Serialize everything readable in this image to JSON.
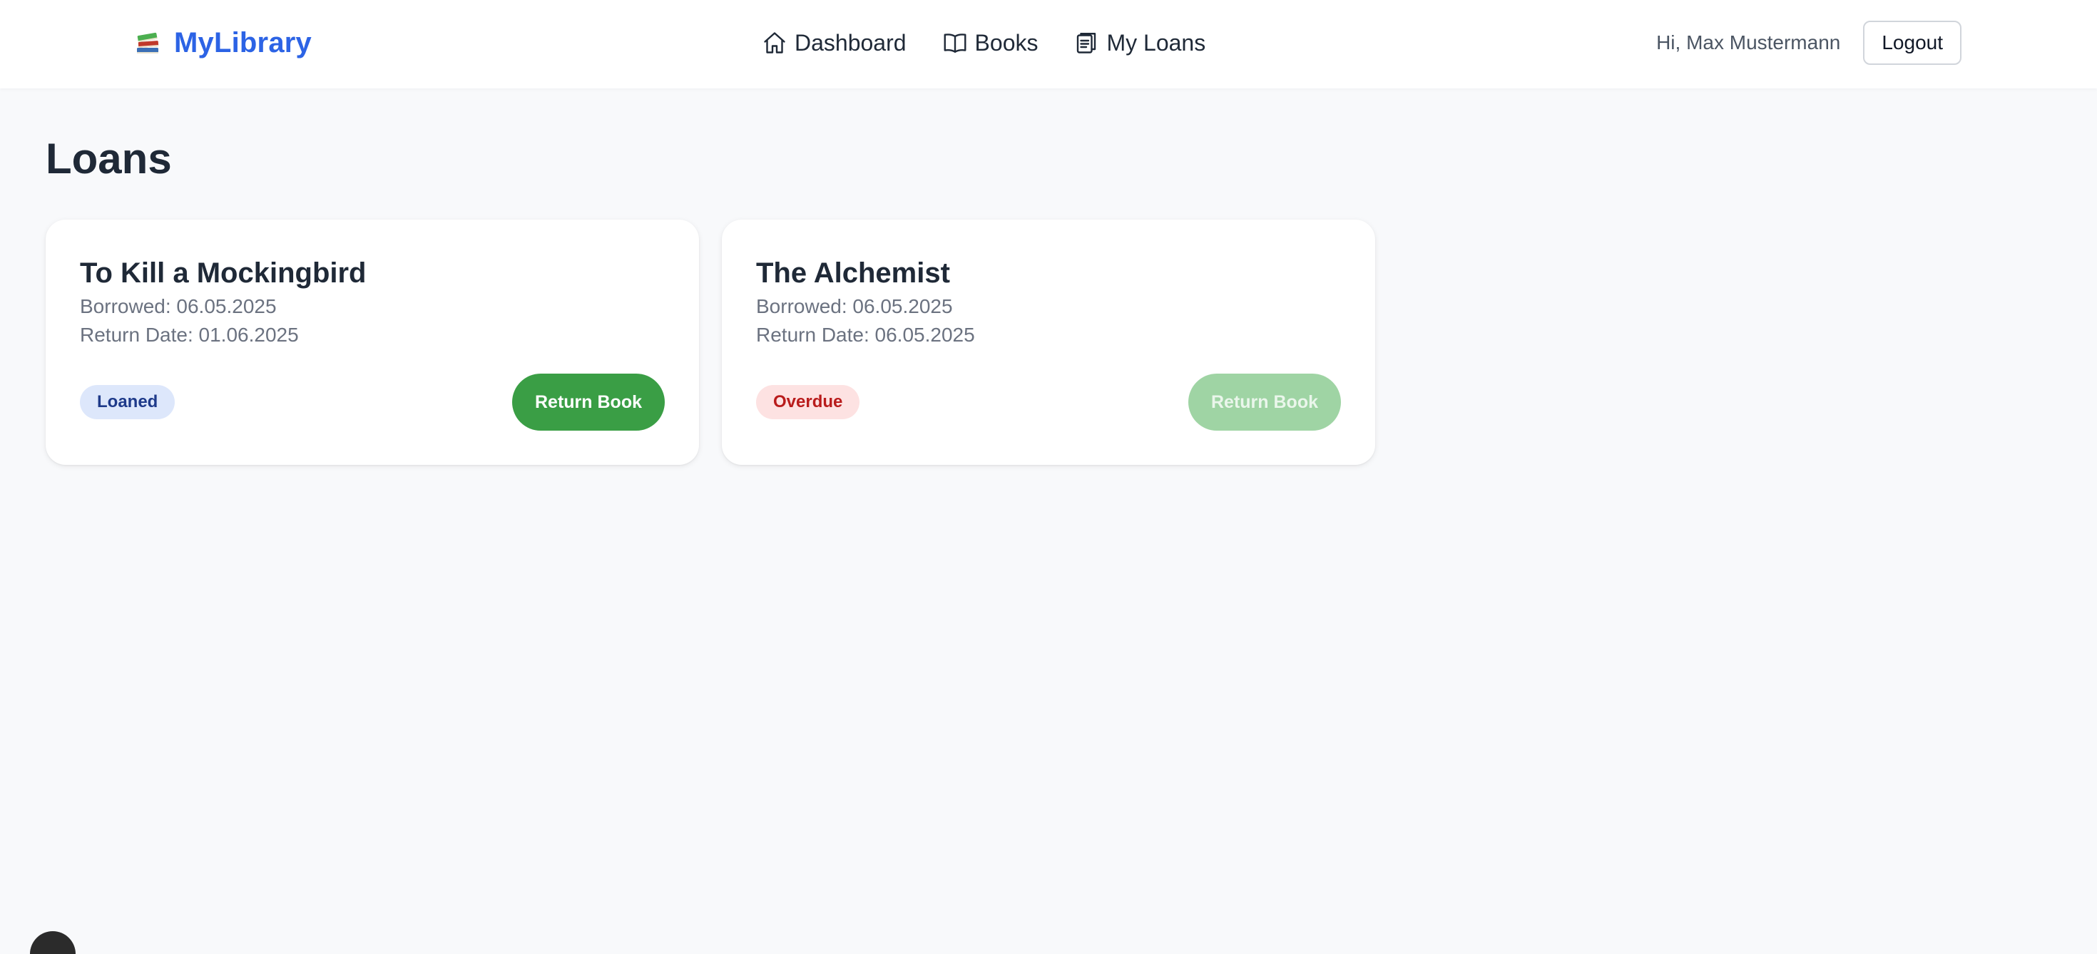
{
  "app": {
    "brand_name": "MyLibrary",
    "brand_icon": "books-stack-icon",
    "brand_color": "#2c63e5"
  },
  "nav": {
    "items": [
      {
        "label": "Dashboard",
        "icon": "home-icon"
      },
      {
        "label": "Books",
        "icon": "open-book-icon"
      },
      {
        "label": "My Loans",
        "icon": "clipboard-icon"
      }
    ]
  },
  "user": {
    "greeting": "Hi, Max Mustermann",
    "logout_label": "Logout"
  },
  "page": {
    "title": "Loans"
  },
  "loans": [
    {
      "title": "To Kill a Mockingbird",
      "borrowed": "Borrowed: 06.05.2025",
      "return_date": "Return Date: 01.06.2025",
      "status": "Loaned",
      "status_color": "#1e3a8a",
      "status_bg": "#dde7fb",
      "action_label": "Return Book",
      "action_enabled": true
    },
    {
      "title": "The Alchemist",
      "borrowed": "Borrowed: 06.05.2025",
      "return_date": "Return Date: 06.05.2025",
      "status": "Overdue",
      "status_color": "#b91c1c",
      "status_bg": "#fde2e2",
      "action_label": "Return Book",
      "action_enabled": false
    }
  ],
  "colors": {
    "accent_green": "#3a9e45",
    "accent_green_disabled": "#9fd4a4",
    "page_background": "#f8f9fb"
  }
}
